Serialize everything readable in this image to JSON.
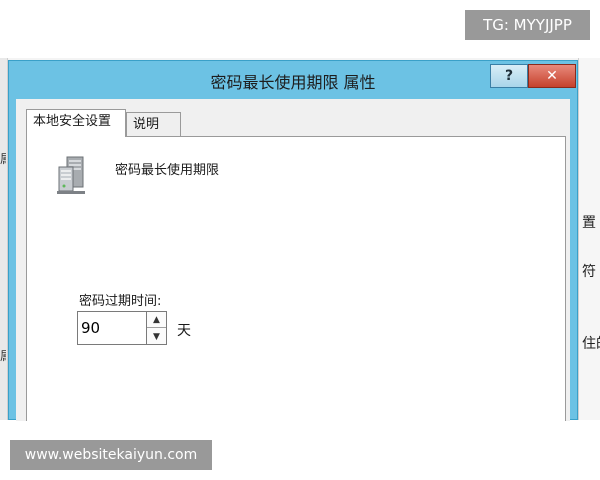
{
  "watermarks": {
    "top_right": "TG: MYYJJPP",
    "bottom_left": "www.websitekaiyun.com"
  },
  "background_window": {
    "left_edge_fragments": [
      "属",
      "属"
    ],
    "right_edge_fragments": [
      "置",
      "符",
      "住的"
    ]
  },
  "dialog": {
    "title": "密码最长使用期限 属性",
    "help_label": "?",
    "close_label": "✕",
    "tabs": [
      {
        "label": "本地安全设置",
        "active": true
      },
      {
        "label": "说明",
        "active": false
      }
    ],
    "policy_icon": "server-policy-icon",
    "policy_name": "密码最长使用期限",
    "expire_label": "密码过期时间:",
    "days_value": "90",
    "unit": "天",
    "spin_up_label": "▲",
    "spin_down_label": "▼"
  },
  "colors": {
    "titlebar": "#6cc2e4",
    "close_button": "#c6412c",
    "watermark_bg": "#999999"
  }
}
